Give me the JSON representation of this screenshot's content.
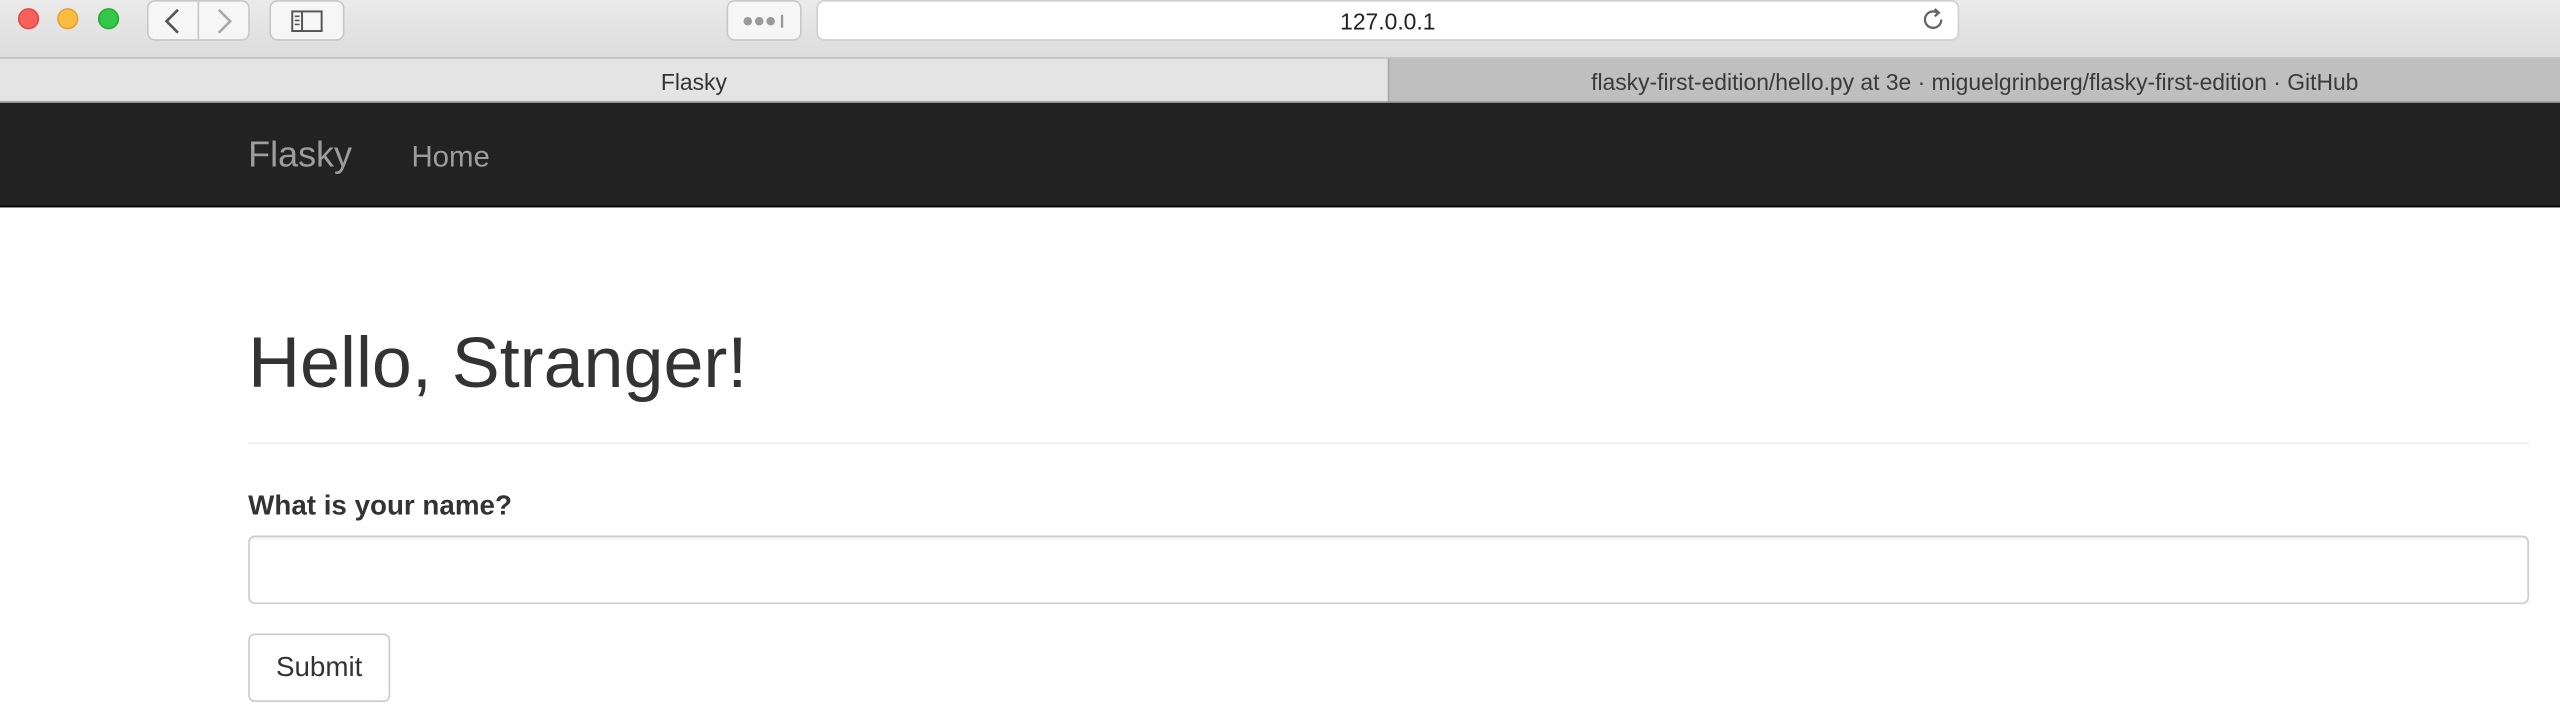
{
  "browser": {
    "url": "127.0.0.1",
    "tabs": [
      {
        "label": "Flasky",
        "active": true
      },
      {
        "label": "flasky-first-edition/hello.py at 3e · miguelgrinberg/flasky-first-edition · GitHub",
        "active": false
      }
    ],
    "icons": [
      "close-light",
      "minimize-light",
      "maximize-light",
      "chevron-left-icon",
      "chevron-right-icon",
      "sidebar-icon",
      "dots-icon",
      "reload-icon"
    ]
  },
  "navbar": {
    "brand": "Flasky",
    "links": [
      {
        "label": "Home"
      }
    ],
    "background": "#222222",
    "text_color": "#9d9d9d"
  },
  "main": {
    "title": "Hello, Stranger!",
    "form": {
      "label": "What is your name?",
      "input_value": "",
      "submit_label": "Submit"
    }
  }
}
